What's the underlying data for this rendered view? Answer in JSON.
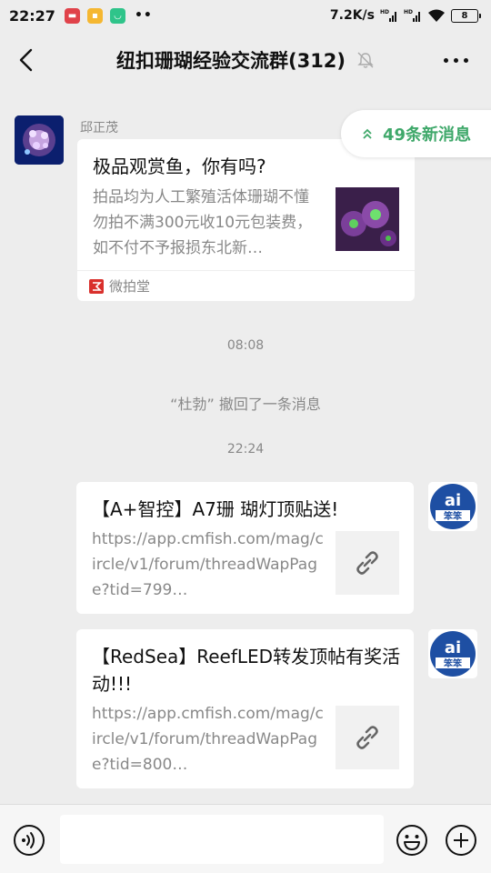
{
  "status_bar": {
    "time": "22:27",
    "net_speed": "7.2K/s",
    "signal_label": "HD",
    "battery": "8"
  },
  "header": {
    "title": "纽扣珊瑚经验交流群(312)"
  },
  "new_messages": {
    "label": "49条新消息"
  },
  "messages": {
    "m1": {
      "sender": "邱正茂",
      "title": "极品观赏鱼，你有吗?",
      "desc": "拍品均为人工繁殖活体珊瑚不懂勿拍不满300元收10元包装费，如不付不予报损东北新…",
      "source": "微拍堂"
    },
    "t1": "08:08",
    "recall": "“杜勃” 撤回了一条消息",
    "t2": "22:24",
    "m2": {
      "title": "【A+智控】A7珊 瑚灯顶贴送!",
      "url": "https://app.cmfish.com/mag/circle/v1/forum/threadWapPage?tid=799…"
    },
    "m3": {
      "title": "【RedSea】ReefLED转发顶帖有奖活动!!!",
      "url": "https://app.cmfish.com/mag/circle/v1/forum/threadWapPage?tid=800…"
    },
    "avatar_badge": "ai"
  },
  "input": {
    "placeholder": ""
  },
  "colors": {
    "accent_green": "#3fa86a",
    "background": "#ededed"
  }
}
